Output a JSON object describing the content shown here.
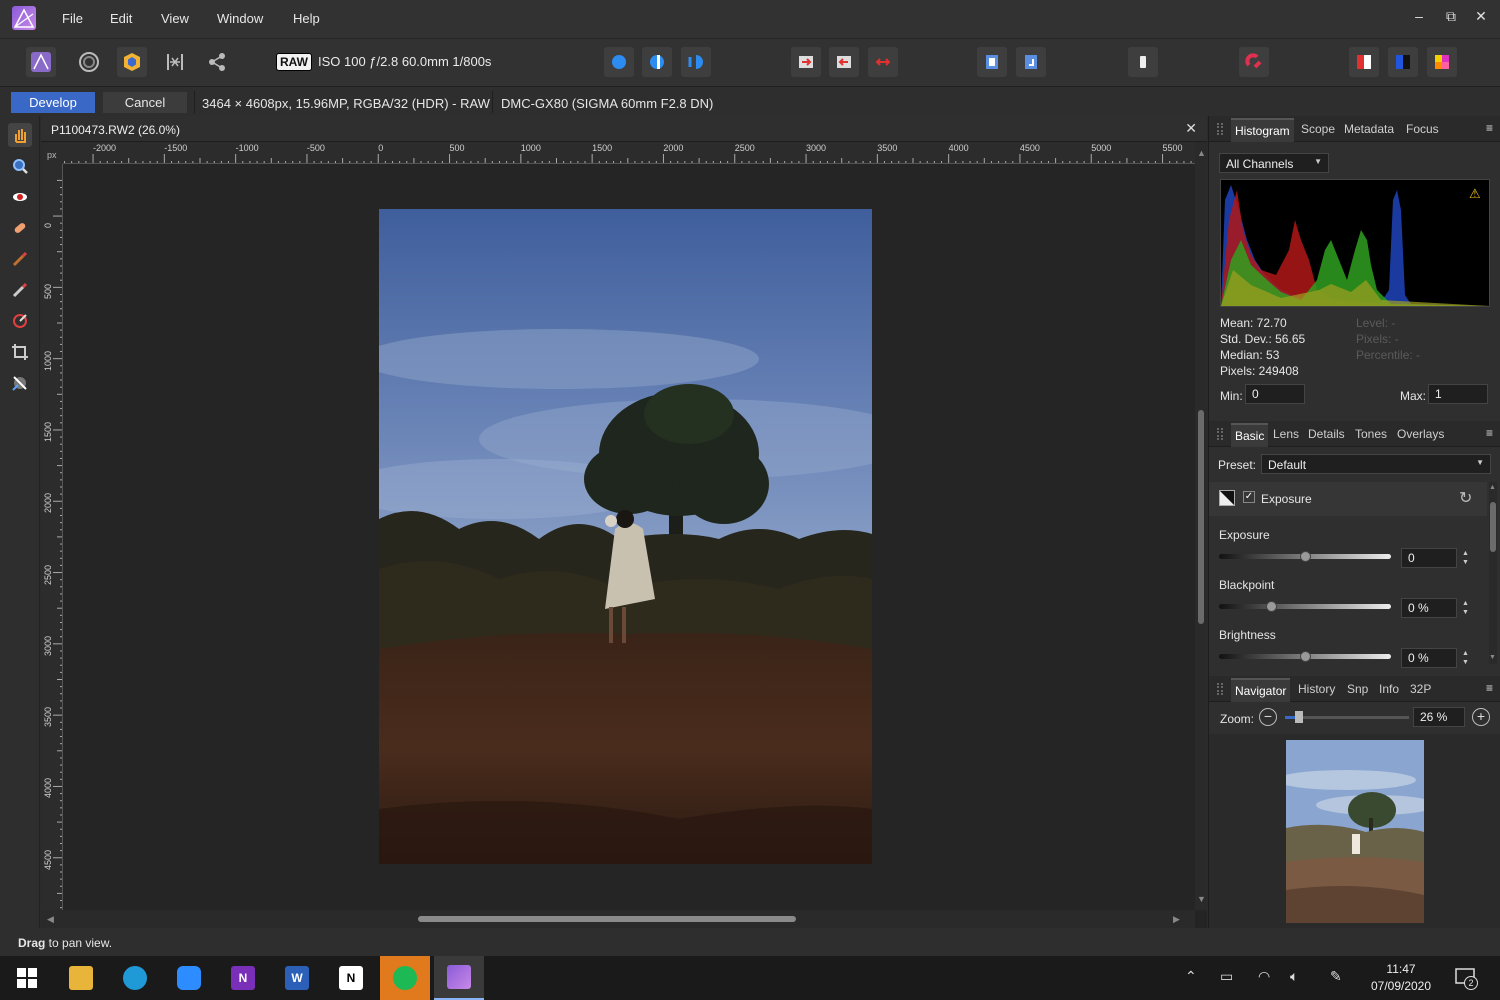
{
  "menubar": {
    "items": [
      "File",
      "Edit",
      "View",
      "Window",
      "Help"
    ],
    "window_controls": [
      "–",
      "⧉",
      "✕"
    ]
  },
  "toolbar": {
    "raw_badge": "RAW",
    "camera_info": "ISO 100 ƒ/2.8 60.0mm 1/800s"
  },
  "context_bar": {
    "develop_label": "Develop",
    "cancel_label": "Cancel",
    "image_info": "3464 × 4608px, 15.96MP, RGBA/32 (HDR) - RAW",
    "camera_model": "DMC-GX80 (SIGMA 60mm F2.8 DN)"
  },
  "document": {
    "title": "P1100473.RW2 (26.0%)",
    "close": "✕",
    "ruler_unit": "px",
    "h_ruler_labels": [
      "-2000",
      "-1500",
      "-1000",
      "-500",
      "0",
      "500",
      "1000",
      "1500",
      "2000",
      "2500",
      "3000",
      "3500",
      "4000",
      "4500",
      "5000",
      "5500"
    ],
    "v_ruler_labels": [
      "0",
      "500",
      "1000",
      "1500",
      "2000",
      "2500",
      "3000",
      "3500",
      "4000",
      "4500"
    ]
  },
  "histogram_panel": {
    "tabs": [
      "Histogram",
      "Scope",
      "Metadata",
      "Focus"
    ],
    "channel": "All Channels",
    "mean": "Mean: 72.70",
    "std_dev": "Std. Dev.: 56.65",
    "median": "Median: 53",
    "pixels": "Pixels: 249408",
    "level": "Level: -",
    "pixels_right": "Pixels: -",
    "percentile": "Percentile: -",
    "min_label": "Min:",
    "min_value": "0",
    "max_label": "Max:",
    "max_value": "1"
  },
  "basic_panel": {
    "tabs": [
      "Basic",
      "Lens",
      "Details",
      "Tones",
      "Overlays"
    ],
    "preset_label": "Preset:",
    "preset_value": "Default",
    "section_label": "Exposure",
    "sliders": [
      {
        "label": "Exposure",
        "value": "0",
        "level": 0.5
      },
      {
        "label": "Blackpoint",
        "value": "0 %",
        "level": 0.3
      },
      {
        "label": "Brightness",
        "value": "0 %",
        "level": 0.5
      }
    ]
  },
  "navigator_panel": {
    "tabs": [
      "Navigator",
      "History",
      "Snp",
      "Info",
      "32P"
    ],
    "zoom_label": "Zoom:",
    "zoom_value": "26 %"
  },
  "status": {
    "bold": "Drag",
    "text": " to pan view."
  },
  "taskbar": {
    "time": "11:47",
    "date": "07/09/2020",
    "notifications": "2"
  },
  "colors": {
    "accent": "#3a68c6",
    "panel": "#2f2f2f",
    "background": "#242424"
  }
}
